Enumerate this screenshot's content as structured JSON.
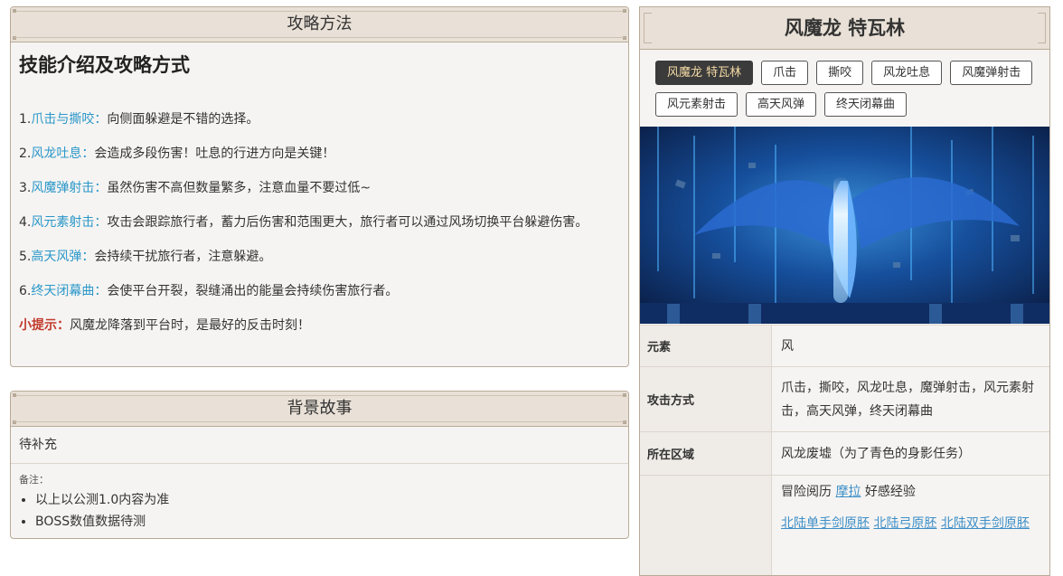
{
  "strategy": {
    "header": "攻略方法",
    "title": "技能介绍及攻略方式",
    "items": [
      {
        "num": "1.",
        "keyword": "爪击与撕咬",
        "sep": "：",
        "text": "向侧面躲避是不错的选择。"
      },
      {
        "num": "2.",
        "keyword": "风龙吐息",
        "sep": "：",
        "text": "会造成多段伤害！吐息的行进方向是关键！"
      },
      {
        "num": "3.",
        "keyword": "风魔弹射击",
        "sep": "：",
        "text": "虽然伤害不高但数量繁多，注意血量不要过低~"
      },
      {
        "num": "4.",
        "keyword": "风元素射击",
        "sep": "：",
        "text": "攻击会跟踪旅行者，蓄力后伤害和范围更大，旅行者可以通过风场切换平台躲避伤害。"
      },
      {
        "num": "5.",
        "keyword": "高天风弹",
        "sep": "：",
        "text": "会持续干扰旅行者，注意躲避。"
      },
      {
        "num": "6.",
        "keyword": "终天闭幕曲",
        "sep": "：",
        "text": "会使平台开裂，裂缝涌出的能量会持续伤害旅行者。"
      }
    ],
    "tip_label": "小提示：",
    "tip_text": "风魔龙降落到平台时，是最好的反击时刻！"
  },
  "story": {
    "header": "背景故事",
    "text": "待补充",
    "notes_label": "备注：",
    "notes": [
      "以上以公测1.0内容为准",
      "BOSS数值数据待测"
    ]
  },
  "boss": {
    "title": "风魔龙 特瓦林",
    "tabs": [
      "风魔龙 特瓦林",
      "爪击",
      "撕咬",
      "风龙吐息",
      "风魔弹射击",
      "风元素射击",
      "高天风弹",
      "终天闭幕曲"
    ],
    "active_tab": 0,
    "image_name": "dragon-artwork",
    "rows": {
      "element_key": "元素",
      "element_val": "风",
      "attack_key": "攻击方式",
      "attack_val": "爪击，撕咬，风龙吐息，魔弹射击，风元素射击，高天风弹，终天闭幕曲",
      "region_key": "所在区域",
      "region_val": "风龙废墟（为了青色的身影任务）",
      "rewards_pre": "冒险阅历",
      "rewards_link": "摩拉",
      "rewards_post": "好感经验",
      "drops": [
        "北陆单手剑原胚",
        "北陆弓原胚",
        "北陆双手剑原胚"
      ]
    }
  },
  "colors": {
    "keyword": "#2a97c9",
    "tip": "#c0392b",
    "panel_bg": "#f6f4f2",
    "header_bg": "#e9e1d7",
    "border": "#b8aa98",
    "active_tab_bg": "#3b3b3b",
    "active_tab_text": "#f3d9a4",
    "link": "#3d8fc8"
  }
}
